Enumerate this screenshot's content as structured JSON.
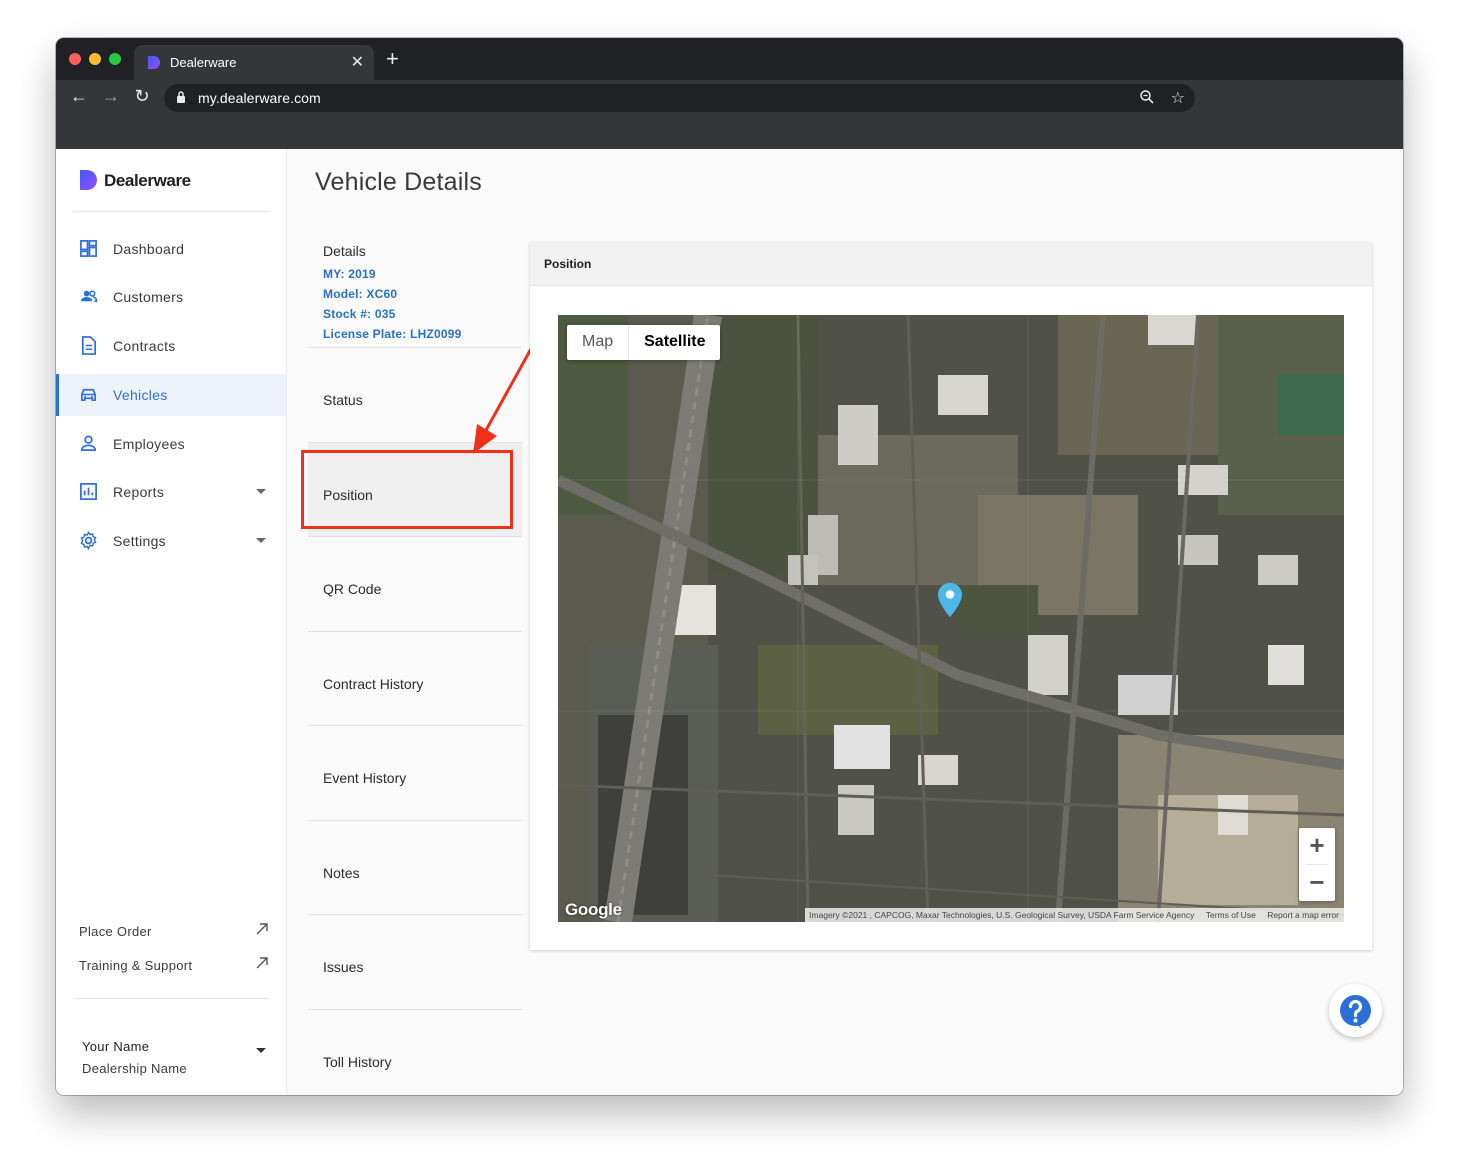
{
  "browser": {
    "tab_title": "Dealerware",
    "new_tab": "+",
    "url": "my.dealerware.com"
  },
  "brand": {
    "name": "Dealerware"
  },
  "sidebar": {
    "items": [
      {
        "label": "Dashboard",
        "icon": "dashboard-icon"
      },
      {
        "label": "Customers",
        "icon": "customers-icon"
      },
      {
        "label": "Contracts",
        "icon": "contracts-icon"
      },
      {
        "label": "Vehicles",
        "icon": "vehicles-icon",
        "active": true
      },
      {
        "label": "Employees",
        "icon": "employees-icon"
      },
      {
        "label": "Reports",
        "icon": "reports-icon",
        "expandable": true
      },
      {
        "label": "Settings",
        "icon": "settings-icon",
        "expandable": true
      }
    ],
    "footer_links": [
      {
        "label": "Place Order",
        "icon": "external-link-icon"
      },
      {
        "label": "Training & Support",
        "icon": "external-link-icon"
      }
    ],
    "user": {
      "name": "Your Name",
      "dealership": "Dealership Name"
    }
  },
  "page": {
    "title": "Vehicle Details"
  },
  "details": {
    "title": "Details",
    "my": "MY: 2019",
    "model": "Model: XC60",
    "stock": "Stock #: 035",
    "plate": "License Plate: LHZ0099"
  },
  "subnav": {
    "items": [
      {
        "label": "Status"
      },
      {
        "label": "Position",
        "selected": true
      },
      {
        "label": "QR Code"
      },
      {
        "label": "Contract History"
      },
      {
        "label": "Event History"
      },
      {
        "label": "Notes"
      },
      {
        "label": "Issues"
      },
      {
        "label": "Toll History"
      }
    ]
  },
  "panel": {
    "title": "Position"
  },
  "map": {
    "type_map": "Map",
    "type_satellite": "Satellite",
    "selected_type": "Satellite",
    "zoom_in": "+",
    "zoom_out": "−",
    "logo": "Google",
    "attribution": "Imagery ©2021 , CAPCOG, Maxar Technologies, U.S. Geological Survey, USDA Farm Service Agency",
    "terms": "Terms of Use",
    "report": "Report a map error",
    "marker_color": "#4db8e8"
  },
  "colors": {
    "accent": "#2d6fd8",
    "highlight": "#f0301a",
    "help": "#2d6fd8"
  }
}
